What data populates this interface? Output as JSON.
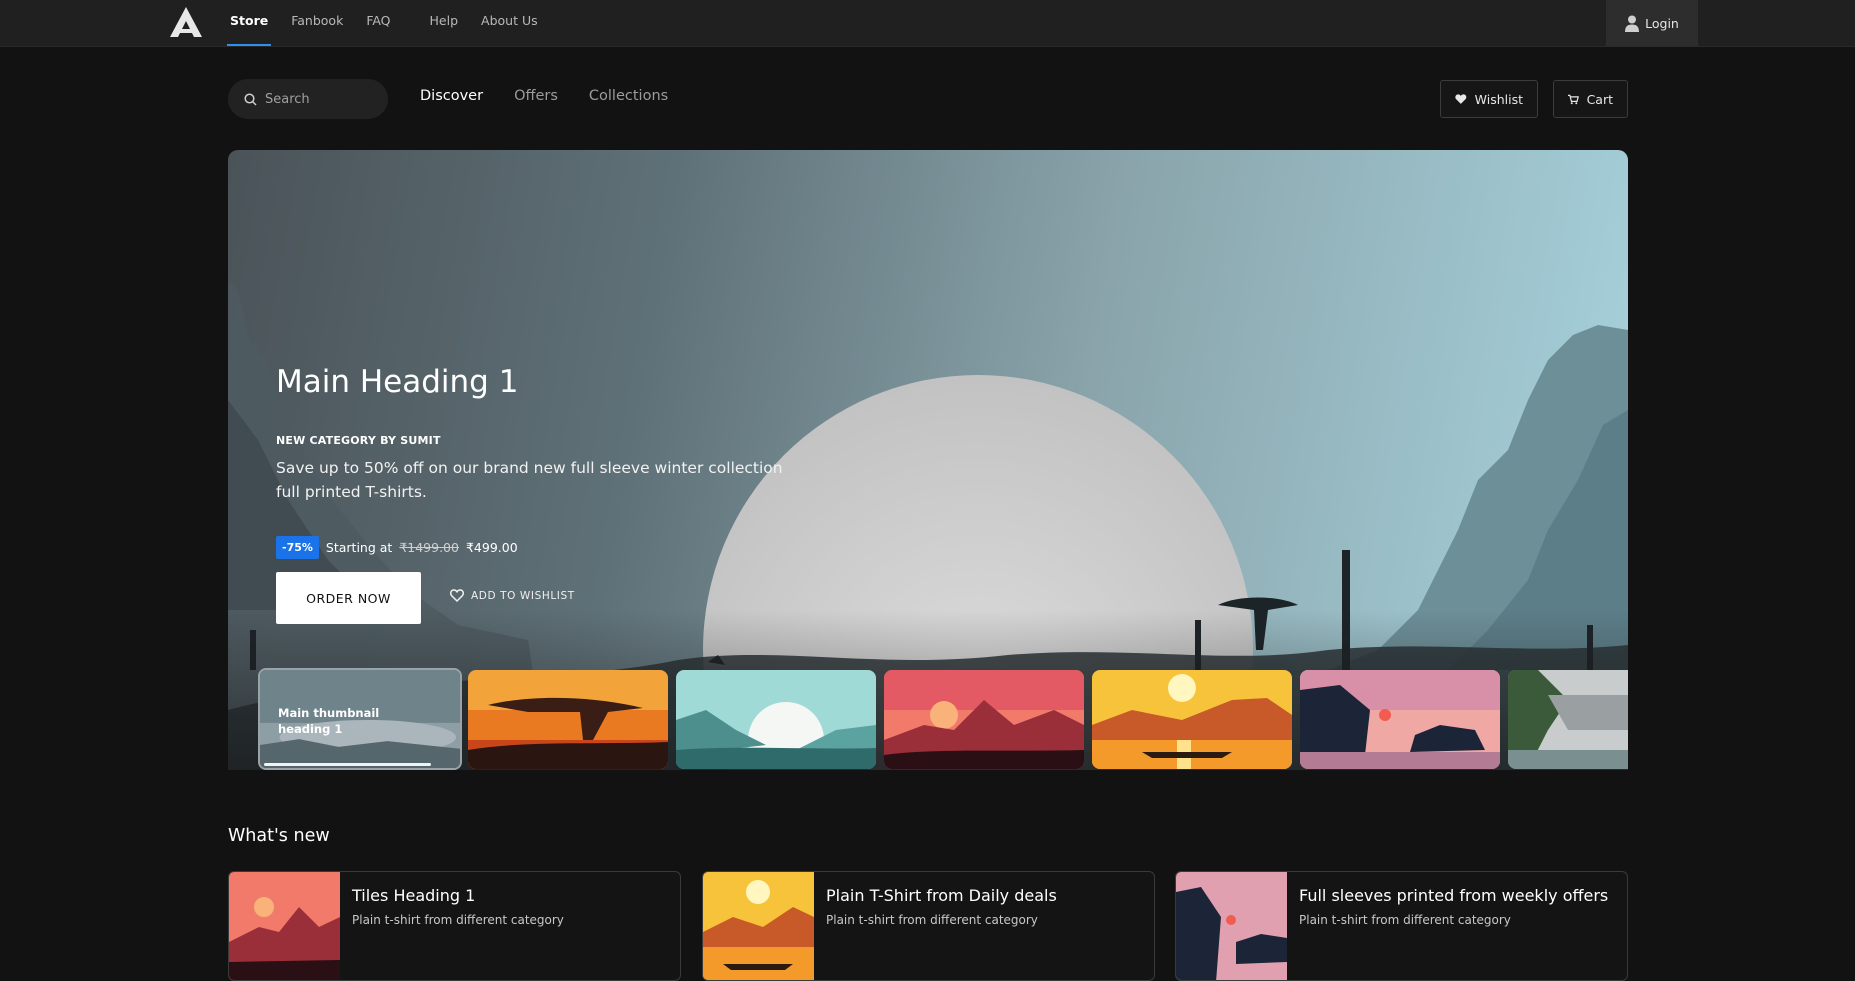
{
  "topnav": {
    "items": [
      "Store",
      "Fanbook",
      "FAQ",
      "Help",
      "About Us"
    ],
    "login_label": "Login"
  },
  "subnav": {
    "search_placeholder": "Search",
    "tabs": [
      "Discover",
      "Offers",
      "Collections"
    ],
    "wishlist_label": "Wishlist",
    "cart_label": "Cart"
  },
  "hero": {
    "title": "Main Heading 1",
    "kicker": "NEW CATEGORY BY SUMIT",
    "description": "Save up to 50% off on our brand new full sleeve winter collection full printed T-shirts.",
    "discount_badge": "-75%",
    "price_prefix": "Starting at",
    "old_price": "₹1499.00",
    "new_price": "₹499.00",
    "order_label": "ORDER NOW",
    "wishlist_label": "ADD TO WISHLIST"
  },
  "thumbnails": {
    "active_label": "Main thumbnail heading 1",
    "active_progress": 0.85,
    "items": [
      "misty-lake",
      "savanna-sunset",
      "teal-sunset",
      "pink-forest",
      "yellow-lake",
      "pink-rocks",
      "grey-cliff"
    ]
  },
  "whats_new": {
    "title": "What's new",
    "tiles": [
      {
        "title": "Tiles Heading 1",
        "subtitle": "Plain t-shirt from different category"
      },
      {
        "title": "Plain T-Shirt from Daily deals",
        "subtitle": "Plain t-shirt from different category"
      },
      {
        "title": "Full sleeves printed from weekly offers",
        "subtitle": "Plain t-shirt from different category"
      }
    ]
  },
  "colors": {
    "accent": "#1a73e8",
    "background": "#121212",
    "topbar": "#202020"
  }
}
